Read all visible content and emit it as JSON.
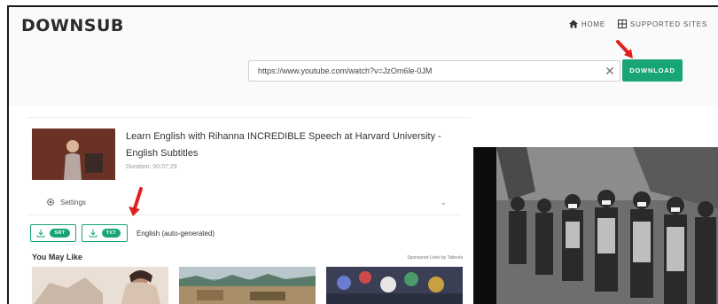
{
  "header": {
    "logo": "DOWNSUB",
    "nav": [
      {
        "label": "HOME",
        "icon": "home-icon"
      },
      {
        "label": "SUPPORTED SITES",
        "icon": "grid-icon"
      }
    ]
  },
  "search": {
    "url_value": "https://www.youtube.com/watch?v=JzOm6le-0JM",
    "download_label": "DOWNLOAD"
  },
  "video": {
    "title": "Learn English with Rihanna INCREDIBLE Speech at Harvard University - English Subtitles",
    "duration_label": "Duration:",
    "duration_value": "00:07:29"
  },
  "settings": {
    "label": "Settings"
  },
  "formats": [
    {
      "label": "SRT"
    },
    {
      "label": "TXT"
    }
  ],
  "subtitle_language": "English (auto-generated)",
  "recommendations": {
    "title": "You May Like",
    "sponsored": "Sponsored Links by Taboola"
  },
  "colors": {
    "accent": "#17a673",
    "annotation": "#e02020"
  }
}
